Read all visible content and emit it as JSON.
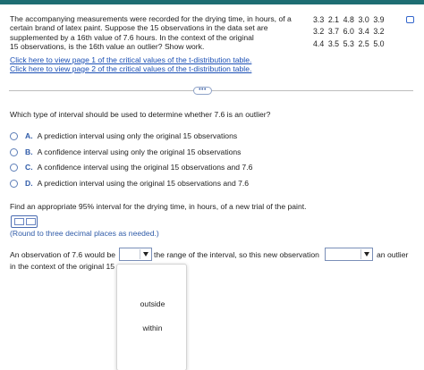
{
  "intro": {
    "line1": "The accompanying measurements were recorded for the drying time, in hours, of a",
    "line2": "certain brand of latex paint. Suppose the 15 observations in the data set are",
    "line3": "supplemented by a 16th value of 7.6 hours. In the context of the original",
    "line4": "15 observations, is the 16th value an outlier? Show work.",
    "link1": "Click here to view page 1 of the critical values of the t-distribution table.",
    "link2": "Click here to view page 2 of the critical values of the t-distribution table."
  },
  "data_rows": [
    [
      "3.3",
      "2.1",
      "4.8",
      "3.0",
      "3.9"
    ],
    [
      "3.2",
      "3.7",
      "6.0",
      "3.4",
      "3.2"
    ],
    [
      "4.4",
      "3.5",
      "5.3",
      "2.5",
      "5.0"
    ]
  ],
  "more_button": "•••",
  "question": "Which type of interval should be used to determine whether 7.6 is an outlier?",
  "options": [
    {
      "letter": "A.",
      "text": "A prediction interval using only the original 15 observations"
    },
    {
      "letter": "B.",
      "text": "A confidence interval using only the original 15 observations"
    },
    {
      "letter": "C.",
      "text": "A confidence interval using the original 15 observations and 7.6"
    },
    {
      "letter": "D.",
      "text": "A prediction interval using the original 15 observations and 7.6"
    }
  ],
  "prompt2": "Find an appropriate 95% interval for the drying time, in hours, of a new trial of the paint.",
  "round_note": "(Round to three decimal places as needed.)",
  "sentence": {
    "part1": "An observation of 7.6 would be",
    "part2": "the range of the interval, so this new observation",
    "part3": "an outlier",
    "part4": "in the context of the original 15 c"
  },
  "dropdown_options": [
    "outside",
    "within"
  ],
  "colors": {
    "accent": "#1e6e73",
    "link": "#1b4fb5",
    "label_blue": "#2f5ba8"
  }
}
